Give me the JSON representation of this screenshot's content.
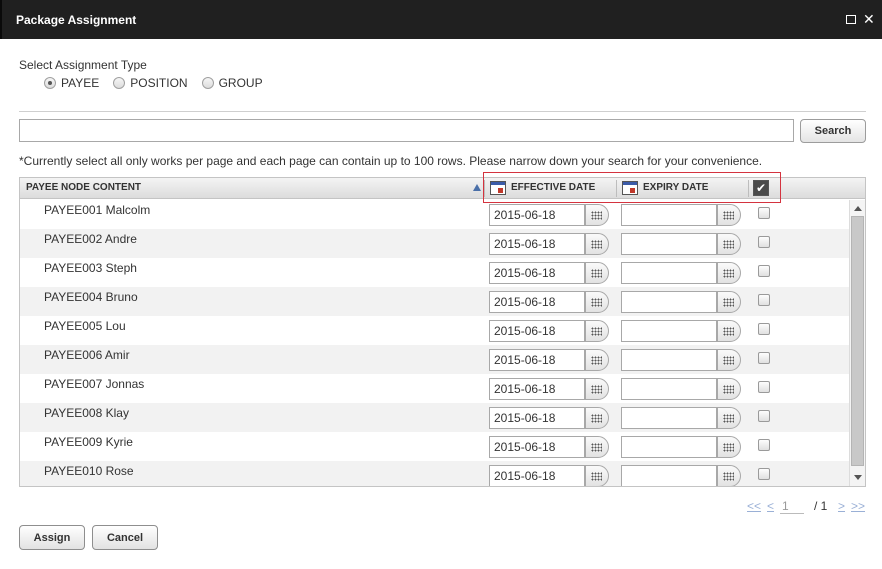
{
  "window": {
    "title": "Package Assignment"
  },
  "assignment_type": {
    "label": "Select Assignment Type",
    "options": [
      {
        "label": "PAYEE",
        "checked": true
      },
      {
        "label": "POSITION",
        "checked": false
      },
      {
        "label": "GROUP",
        "checked": false
      }
    ]
  },
  "search": {
    "value": "",
    "placeholder": "",
    "button_label": "Search"
  },
  "note": "*Currently select all only works per page and each page can contain up to 100 rows. Please narrow down your search for your convenience.",
  "grid": {
    "columns": {
      "name": "PAYEE NODE CONTENT",
      "effective": "EFFECTIVE DATE",
      "expiry": "EXPIRY DATE"
    },
    "rows": [
      {
        "name": "PAYEE001 Malcolm",
        "effective": "2015-06-18",
        "expiry": ""
      },
      {
        "name": "PAYEE002 Andre",
        "effective": "2015-06-18",
        "expiry": ""
      },
      {
        "name": "PAYEE003 Steph",
        "effective": "2015-06-18",
        "expiry": ""
      },
      {
        "name": "PAYEE004 Bruno",
        "effective": "2015-06-18",
        "expiry": ""
      },
      {
        "name": "PAYEE005 Lou",
        "effective": "2015-06-18",
        "expiry": ""
      },
      {
        "name": "PAYEE006 Amir",
        "effective": "2015-06-18",
        "expiry": ""
      },
      {
        "name": "PAYEE007 Jonnas",
        "effective": "2015-06-18",
        "expiry": ""
      },
      {
        "name": "PAYEE008 Klay",
        "effective": "2015-06-18",
        "expiry": ""
      },
      {
        "name": "PAYEE009 Kyrie",
        "effective": "2015-06-18",
        "expiry": ""
      },
      {
        "name": "PAYEE010 Rose",
        "effective": "2015-06-18",
        "expiry": ""
      }
    ]
  },
  "pager": {
    "first": "<<",
    "prev": "<",
    "page": "1",
    "of": "/ 1",
    "next": ">",
    "last": ">>"
  },
  "footer": {
    "assign_label": "Assign",
    "cancel_label": "Cancel"
  },
  "colors": {
    "titlebar": "#202020",
    "highlight": "#d4333f",
    "link": "#9ab0d6"
  }
}
